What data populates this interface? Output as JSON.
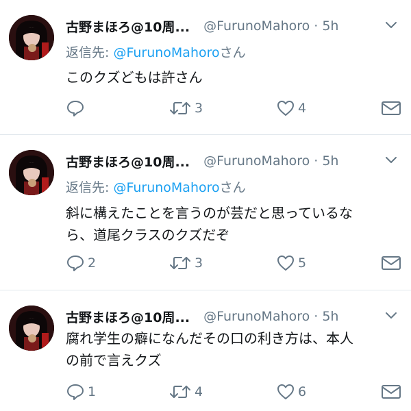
{
  "colors": {
    "link": "#1da1f2",
    "secondary": "#657786",
    "text": "#14171a",
    "divider": "#e1e8ed"
  },
  "tweets": [
    {
      "display_name": "古野まほろ@10周...",
      "handle": "@FurunoMahoro",
      "separator": "·",
      "time": "5h",
      "reply_prefix": "返信先: ",
      "reply_mention": "@FurunoMahoro",
      "reply_suffix": "さん",
      "text_lines": [
        "このクズどもは許さん"
      ],
      "replies": "",
      "retweets": "3",
      "likes": "4"
    },
    {
      "display_name": "古野まほろ@10周...",
      "handle": "@FurunoMahoro",
      "separator": "·",
      "time": "5h",
      "reply_prefix": "返信先: ",
      "reply_mention": "@FurunoMahoro",
      "reply_suffix": "さん",
      "text_lines": [
        "斜に構えたことを言うのが芸だと思っているな",
        "ら、道尾クラスのクズだぞ"
      ],
      "replies": "2",
      "retweets": "3",
      "likes": "5"
    },
    {
      "display_name": "古野まほろ@10周...",
      "handle": "@FurunoMahoro",
      "separator": "·",
      "time": "5h",
      "text_lines": [
        "腐れ学生の癖になんだその口の利き方は、本人",
        "の前で言えクズ"
      ],
      "replies": "1",
      "retweets": "4",
      "likes": "6"
    }
  ]
}
